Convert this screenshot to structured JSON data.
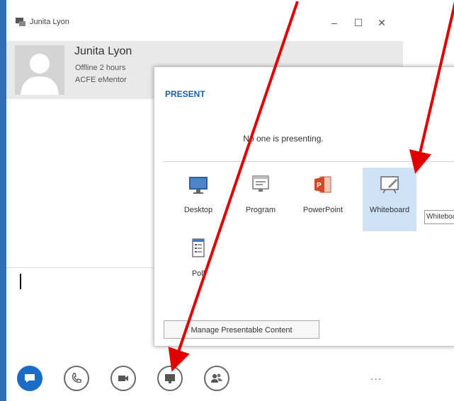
{
  "window": {
    "title": "Junita Lyon",
    "controls": {
      "minimize": "–",
      "maximize": "☐",
      "close": "✕"
    }
  },
  "contact": {
    "name": "Junita Lyon",
    "status": "Offline 2 hours",
    "company": "ACFE eMentor"
  },
  "present_menu": {
    "heading": "PRESENT",
    "status_text": "No one is presenting.",
    "options": [
      {
        "label": "Desktop",
        "icon": "desktop-icon"
      },
      {
        "label": "Program",
        "icon": "program-icon"
      },
      {
        "label": "PowerPoint",
        "icon": "powerpoint-icon"
      },
      {
        "label": "Whiteboard",
        "icon": "whiteboard-icon",
        "selected": true
      },
      {
        "label": "Poll",
        "icon": "poll-icon"
      }
    ],
    "tooltip": "Whiteboard",
    "manage_button": "Manage Presentable Content"
  },
  "bottom_bar": {
    "buttons": [
      {
        "name": "im-button",
        "icon": "chat-bubble-icon",
        "active": true
      },
      {
        "name": "call-button",
        "icon": "phone-icon"
      },
      {
        "name": "video-button",
        "icon": "video-camera-icon"
      },
      {
        "name": "present-button",
        "icon": "present-monitor-icon"
      },
      {
        "name": "participants-button",
        "icon": "people-icon"
      }
    ],
    "more": "..."
  },
  "colors": {
    "accent": "#1b6cc4",
    "heading": "#1b5fa7",
    "selected_bg": "#cfe3f7",
    "arrow": "#e00000"
  }
}
